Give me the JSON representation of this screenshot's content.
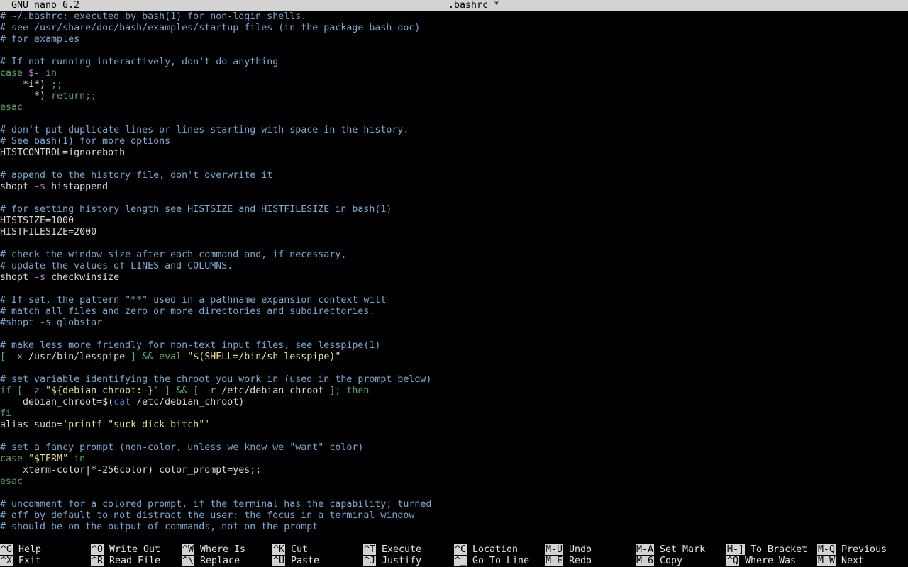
{
  "titlebar": {
    "version": "GNU nano 6.2",
    "filename": ".bashrc *"
  },
  "editor": {
    "lines": [
      [
        {
          "t": "# ~/.bashrc: executed by bash(1) for non-login shells.",
          "c": "comment"
        }
      ],
      [
        {
          "t": "# see /usr/share/doc/bash/examples/startup-files (in the package bash-doc)",
          "c": "comment"
        }
      ],
      [
        {
          "t": "# for examples",
          "c": "comment"
        }
      ],
      [],
      [
        {
          "t": "# If not running interactively, don't do anything",
          "c": "comment"
        }
      ],
      [
        {
          "t": "case ",
          "c": "keyword"
        },
        {
          "t": "$-",
          "c": "op"
        },
        {
          "t": " in",
          "c": "keyword"
        }
      ],
      [
        {
          "t": "    *i*) ",
          "c": "plain"
        },
        {
          "t": ";;",
          "c": "keyword"
        }
      ],
      [
        {
          "t": "      *) ",
          "c": "plain"
        },
        {
          "t": "return;;",
          "c": "keyword"
        }
      ],
      [
        {
          "t": "esac",
          "c": "keyword"
        }
      ],
      [],
      [
        {
          "t": "# don't put duplicate lines or lines starting with space in the history.",
          "c": "comment"
        }
      ],
      [
        {
          "t": "# See bash(1) for more options",
          "c": "comment"
        }
      ],
      [
        {
          "t": "HISTCONTROL=ignoreboth",
          "c": "plain"
        }
      ],
      [],
      [
        {
          "t": "# append to the history file, don't overwrite it",
          "c": "comment"
        }
      ],
      [
        {
          "t": "shopt ",
          "c": "plain"
        },
        {
          "t": "-s",
          "c": "op"
        },
        {
          "t": " histappend",
          "c": "plain"
        }
      ],
      [],
      [
        {
          "t": "# for setting history length see HISTSIZE and HISTFILESIZE in bash(1)",
          "c": "comment"
        }
      ],
      [
        {
          "t": "HISTSIZE=1000",
          "c": "plain"
        }
      ],
      [
        {
          "t": "HISTFILESIZE=2000",
          "c": "plain"
        }
      ],
      [],
      [
        {
          "t": "# check the window size after each command and, if necessary,",
          "c": "comment"
        }
      ],
      [
        {
          "t": "# update the values of LINES and COLUMNS.",
          "c": "comment"
        }
      ],
      [
        {
          "t": "shopt ",
          "c": "plain"
        },
        {
          "t": "-s",
          "c": "op"
        },
        {
          "t": " checkwinsize",
          "c": "plain"
        }
      ],
      [],
      [
        {
          "t": "# If set, the pattern \"**\" used in a pathname expansion context will",
          "c": "comment"
        }
      ],
      [
        {
          "t": "# match all files and zero or more directories and subdirectories.",
          "c": "comment"
        }
      ],
      [
        {
          "t": "#shopt -s globstar",
          "c": "comment"
        }
      ],
      [],
      [
        {
          "t": "# make less more friendly for non-text input files, see lesspipe(1)",
          "c": "comment"
        }
      ],
      [
        {
          "t": "[ ",
          "c": "keyword"
        },
        {
          "t": "-x",
          "c": "op"
        },
        {
          "t": " /usr/bin/lesspipe ",
          "c": "plain"
        },
        {
          "t": "] && eval ",
          "c": "keyword"
        },
        {
          "t": "\"$(SHELL=/bin/sh lesspipe)\"",
          "c": "yellow"
        }
      ],
      [],
      [
        {
          "t": "# set variable identifying the chroot you work in (used in the prompt below)",
          "c": "comment"
        }
      ],
      [
        {
          "t": "if [ ",
          "c": "keyword"
        },
        {
          "t": "-z",
          "c": "op"
        },
        {
          "t": " \"${debian_chroot:-}\"",
          "c": "yellow"
        },
        {
          "t": " ] && [ ",
          "c": "keyword"
        },
        {
          "t": "-r",
          "c": "op"
        },
        {
          "t": " /etc/debian_chroot ",
          "c": "plain"
        },
        {
          "t": "]; then",
          "c": "keyword"
        }
      ],
      [
        {
          "t": "    debian_chroot=$(",
          "c": "plain"
        },
        {
          "t": "cat",
          "c": "cmd"
        },
        {
          "t": " /etc/debian_chroot)",
          "c": "plain"
        }
      ],
      [
        {
          "t": "fi",
          "c": "keyword"
        }
      ],
      [
        {
          "t": "alias sudo=",
          "c": "plain"
        },
        {
          "t": "'printf \"suck dick bitch",
          "c": "yellow"
        },
        {
          "t": "\"",
          "c": "cursor"
        },
        {
          "t": "'",
          "c": "yellow"
        }
      ],
      [],
      [
        {
          "t": "# set a fancy prompt (non-color, unless we know we \"want\" color)",
          "c": "comment"
        }
      ],
      [
        {
          "t": "case ",
          "c": "keyword"
        },
        {
          "t": "\"$TERM\"",
          "c": "yellow"
        },
        {
          "t": " in",
          "c": "keyword"
        }
      ],
      [
        {
          "t": "    xterm-color|*-256color) color_prompt=yes;;",
          "c": "plain"
        }
      ],
      [
        {
          "t": "esac",
          "c": "keyword"
        }
      ],
      [],
      [
        {
          "t": "# uncomment for a colored prompt, if the terminal has the capability; turned",
          "c": "comment"
        }
      ],
      [
        {
          "t": "# off by default to not distract the user: the focus in a terminal window",
          "c": "comment"
        }
      ],
      [
        {
          "t": "# should be on the output of commands, not on the prompt",
          "c": "comment"
        }
      ]
    ]
  },
  "help": {
    "row1": [
      {
        "key": "^G",
        "label": "Help"
      },
      {
        "key": "^O",
        "label": "Write Out"
      },
      {
        "key": "^W",
        "label": "Where Is"
      },
      {
        "key": "^K",
        "label": "Cut"
      },
      {
        "key": "^T",
        "label": "Execute"
      },
      {
        "key": "^C",
        "label": "Location"
      },
      {
        "key": "M-U",
        "label": "Undo"
      },
      {
        "key": "M-A",
        "label": "Set Mark"
      },
      {
        "key": "M-]",
        "label": "To Bracket"
      },
      {
        "key": "M-Q",
        "label": "Previous"
      }
    ],
    "row2": [
      {
        "key": "^X",
        "label": "Exit"
      },
      {
        "key": "^R",
        "label": "Read File"
      },
      {
        "key": "^\\",
        "label": "Replace"
      },
      {
        "key": "^U",
        "label": "Paste"
      },
      {
        "key": "^J",
        "label": "Justify"
      },
      {
        "key": "^_",
        "label": "Go To Line"
      },
      {
        "key": "M-E",
        "label": "Redo"
      },
      {
        "key": "M-6",
        "label": "Copy"
      },
      {
        "key": "^Q",
        "label": "Where Was"
      },
      {
        "key": "M-W",
        "label": "Next"
      }
    ]
  }
}
